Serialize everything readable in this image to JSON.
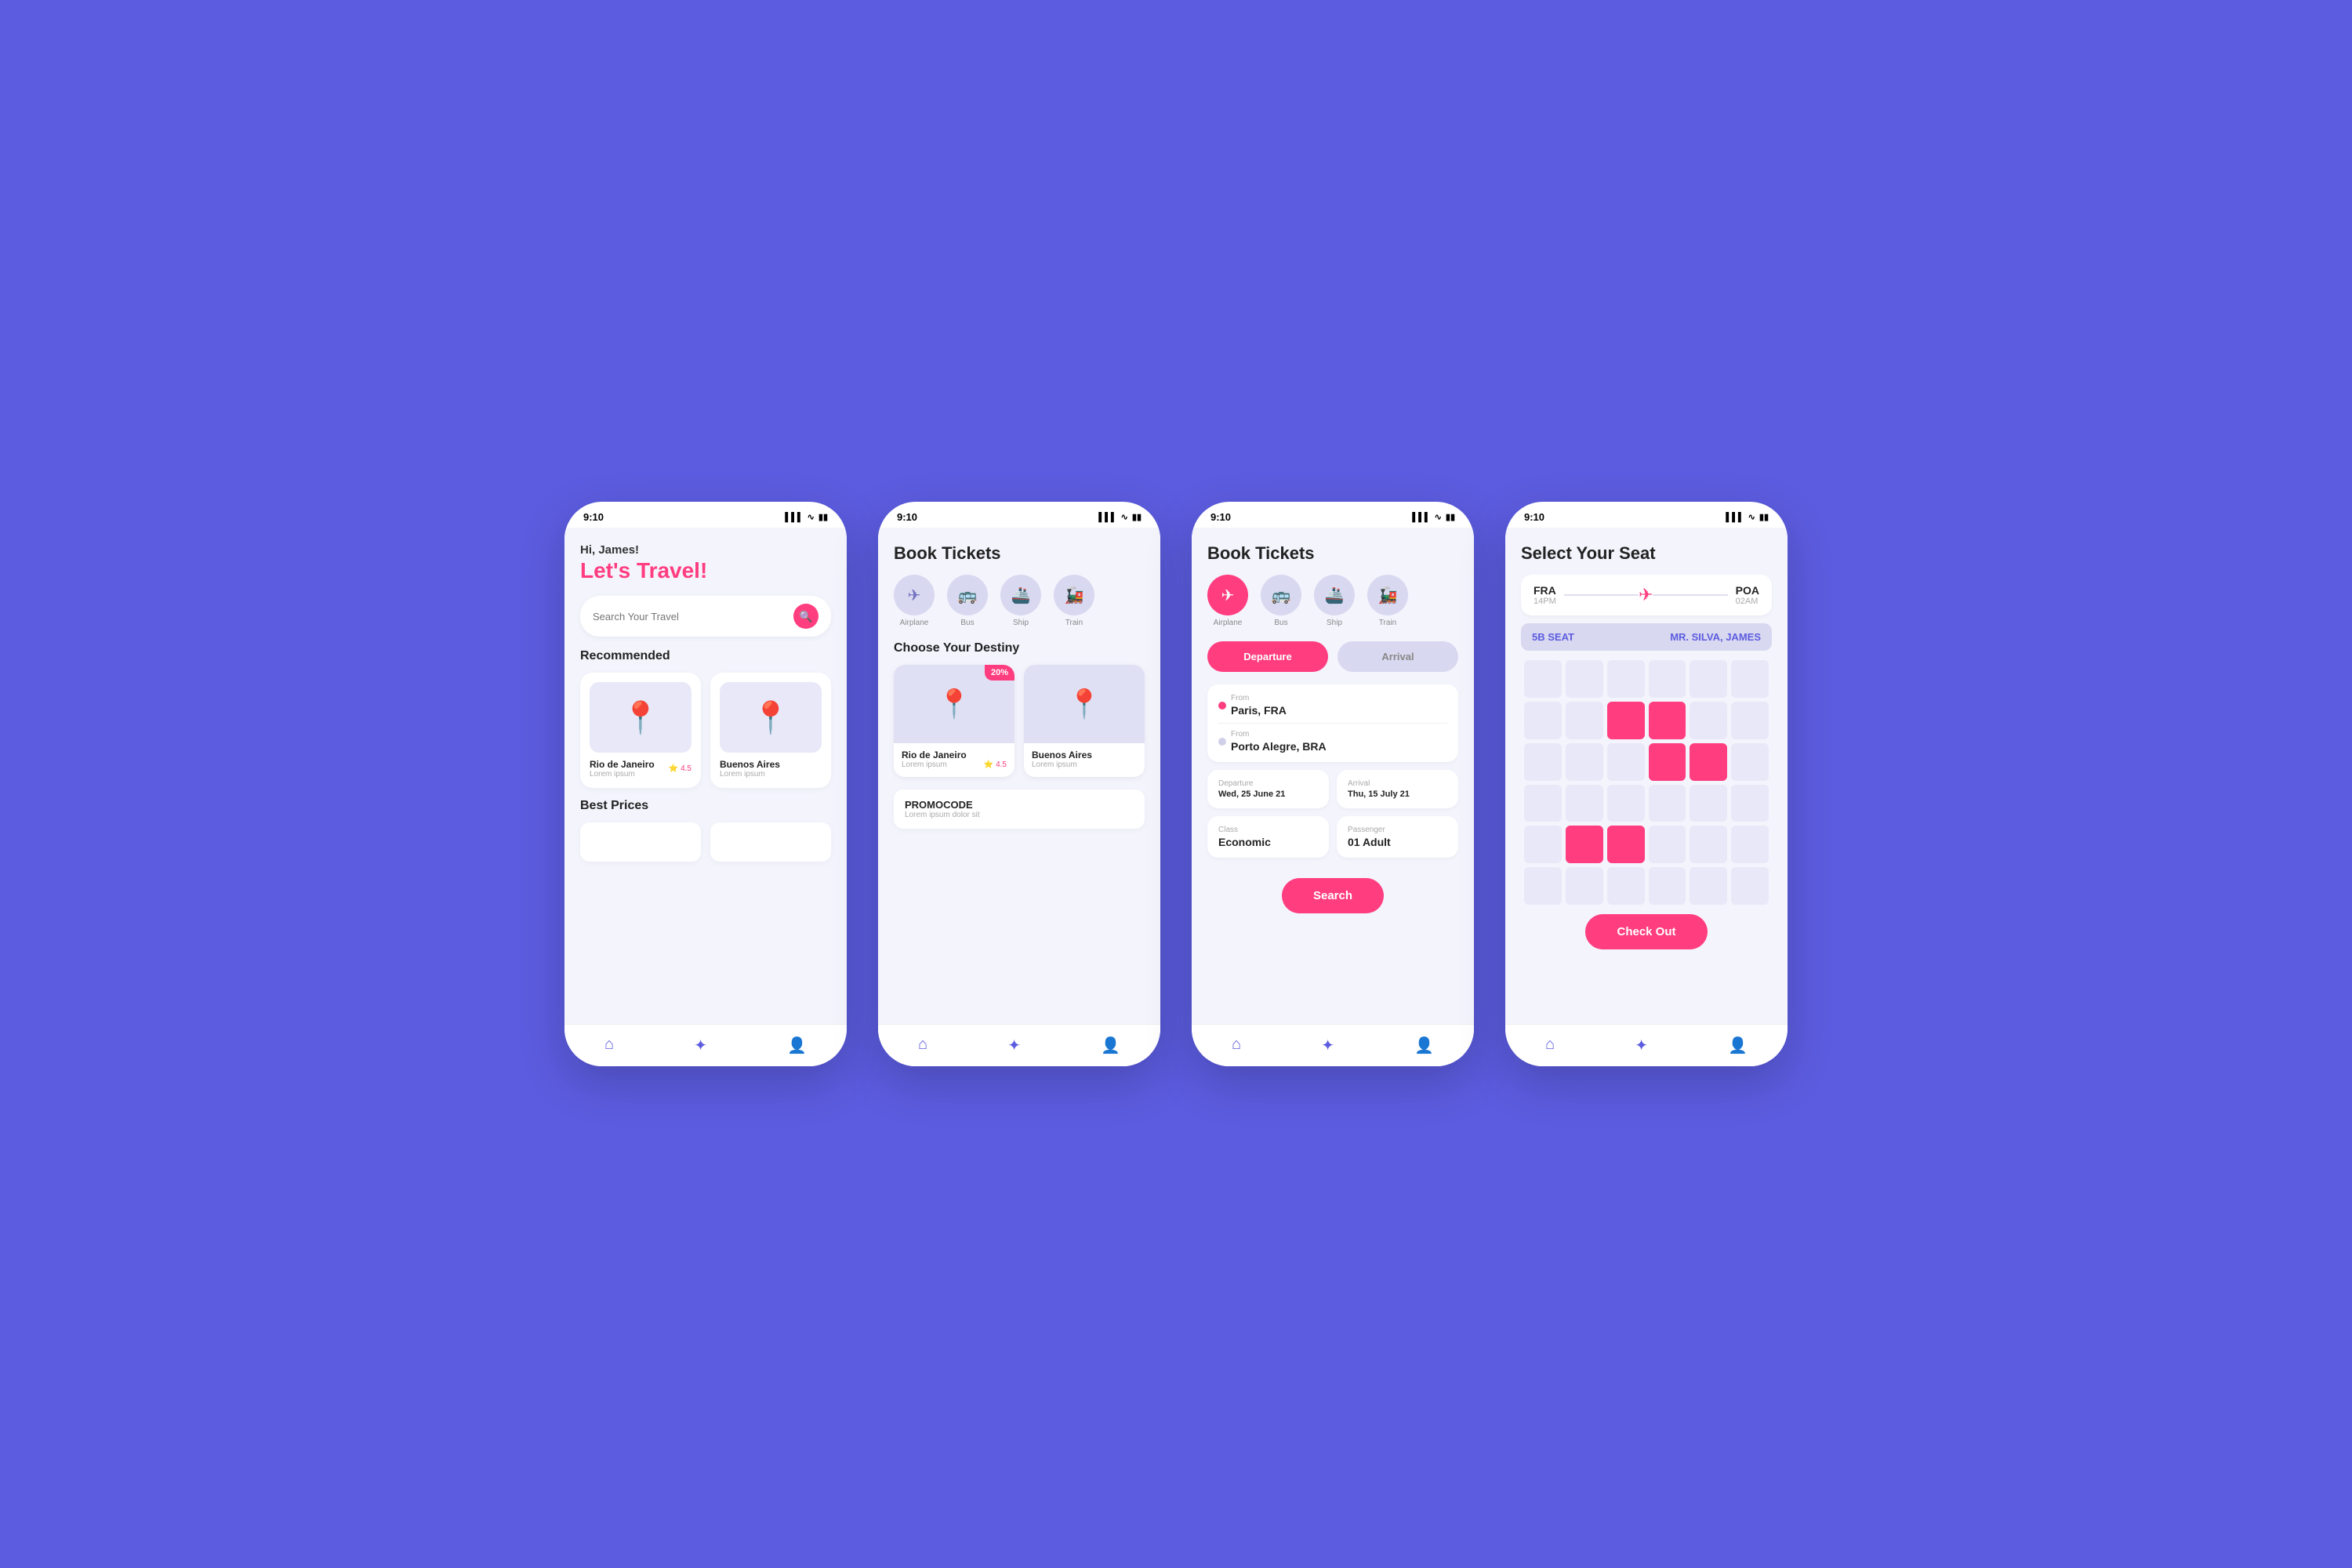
{
  "background": "#5C5CE0",
  "phones": {
    "phone1": {
      "status_time": "9:10",
      "greeting_sub": "Hi, James!",
      "greeting_main": "Let's Travel!",
      "search_placeholder": "Search Your Travel",
      "section_recommended": "Recommended",
      "section_best_prices": "Best Prices",
      "destinations": [
        {
          "name": "Rio de Janeiro",
          "sub": "Lorem ipsum",
          "rating": "4.5"
        },
        {
          "name": "Buenos Aires",
          "sub": "Lorem ipsum",
          "rating": ""
        }
      ]
    },
    "phone2": {
      "status_time": "9:10",
      "page_title": "Book Tickets",
      "transport": [
        "Airplane",
        "Bus",
        "Ship",
        "Train"
      ],
      "destiny_title": "Choose Your Destiny",
      "destinations": [
        {
          "name": "Rio de Janeiro",
          "sub": "Lorem ipsum",
          "rating": "4.5",
          "discount": "20%"
        },
        {
          "name": "Buenos Aires",
          "sub": "Lorem ipsum"
        }
      ],
      "promo_title": "PROMOCODE",
      "promo_sub": "Lorem ipsum dolor sit"
    },
    "phone3": {
      "status_time": "9:10",
      "page_title": "Book Tickets",
      "transport": [
        "Airplane",
        "Bus",
        "Ship",
        "Train"
      ],
      "tab_departure": "Departure",
      "tab_arrival": "Arrival",
      "from_label": "From",
      "from_value": "Paris, FRA",
      "to_label": "From",
      "to_value": "Porto Alegre, BRA",
      "departure_label": "Departure",
      "departure_value": "Wed, 25 June 21",
      "arrival_label": "Arrival",
      "arrival_value": "Thu, 15 July 21",
      "class_label": "Class",
      "class_value": "Economic",
      "passenger_label": "Passenger",
      "passenger_value": "01 Adult",
      "search_btn": "Search"
    },
    "phone4": {
      "status_time": "9:10",
      "page_title": "Select Your Seat",
      "route_from": "FRA",
      "route_from_time": "14PM",
      "route_to": "POA",
      "route_to_time": "02AM",
      "seat_label": "5B SEAT",
      "passenger_label": "MR. SILVA, JAMES",
      "checkout_btn": "Check Out"
    }
  }
}
